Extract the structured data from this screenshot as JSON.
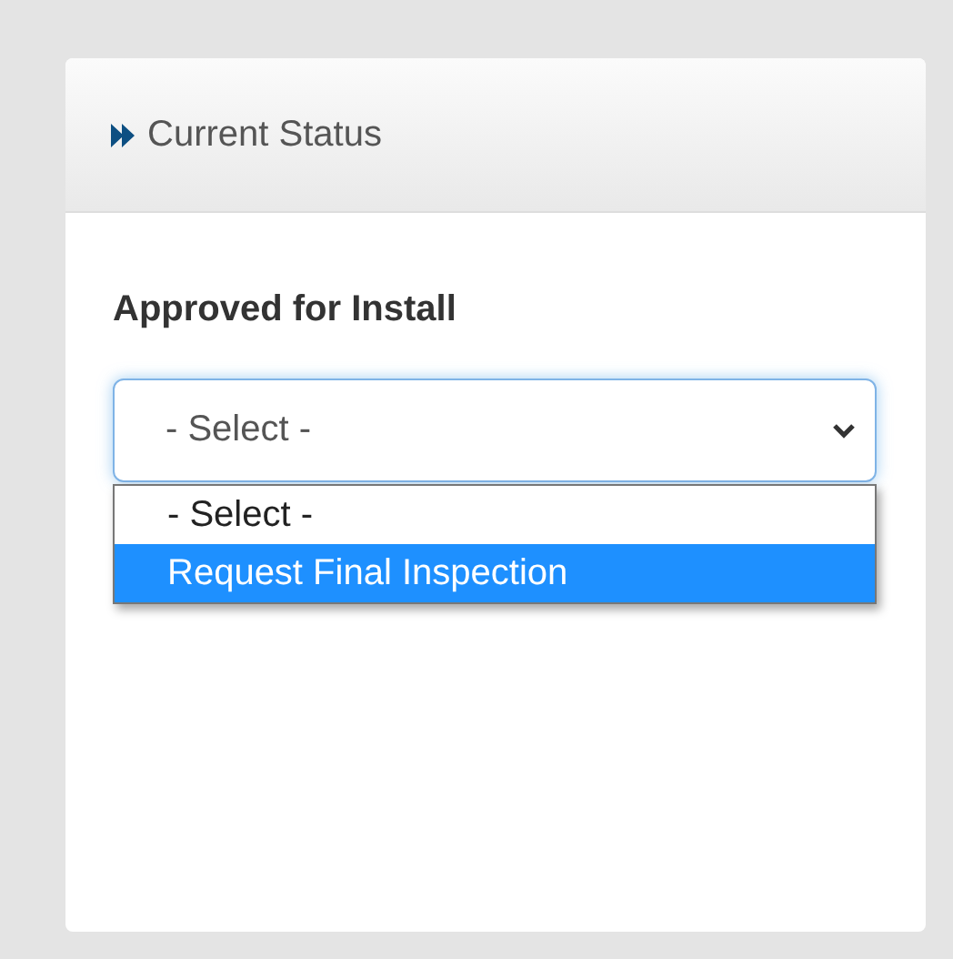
{
  "panel": {
    "title": "Current Status"
  },
  "field": {
    "label": "Approved for Install",
    "value": "- Select -",
    "expanded": true
  },
  "options": [
    {
      "label": "- Select -",
      "selected": false
    },
    {
      "label": "Request Final Inspection",
      "selected": true
    }
  ]
}
